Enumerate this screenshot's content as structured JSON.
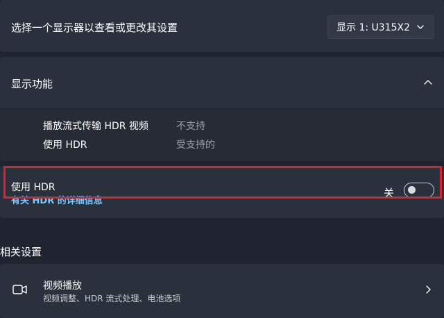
{
  "selector": {
    "label": "选择一个显示器以查看或更改其设置",
    "dropdown_value": "显示 1: U315X2"
  },
  "capabilities": {
    "header": "显示功能",
    "rows": [
      {
        "label": "播放流式传输 HDR 视频",
        "value": "不支持"
      },
      {
        "label": "使用 HDR",
        "value": "受支持的"
      }
    ]
  },
  "hdr_toggle": {
    "title": "使用 HDR",
    "link": "有关 HDR 的详细信息",
    "state_label": "关",
    "state": "off"
  },
  "related": {
    "heading": "相关设置",
    "video": {
      "title": "视频播放",
      "subtitle": "视频调整、HDR 流式处理、电池选项",
      "icon": "video-camera-icon"
    }
  },
  "colors": {
    "background": "#1f2430",
    "card": "#2a303c",
    "link": "#7fc8ff",
    "highlight": "#d9232f"
  }
}
